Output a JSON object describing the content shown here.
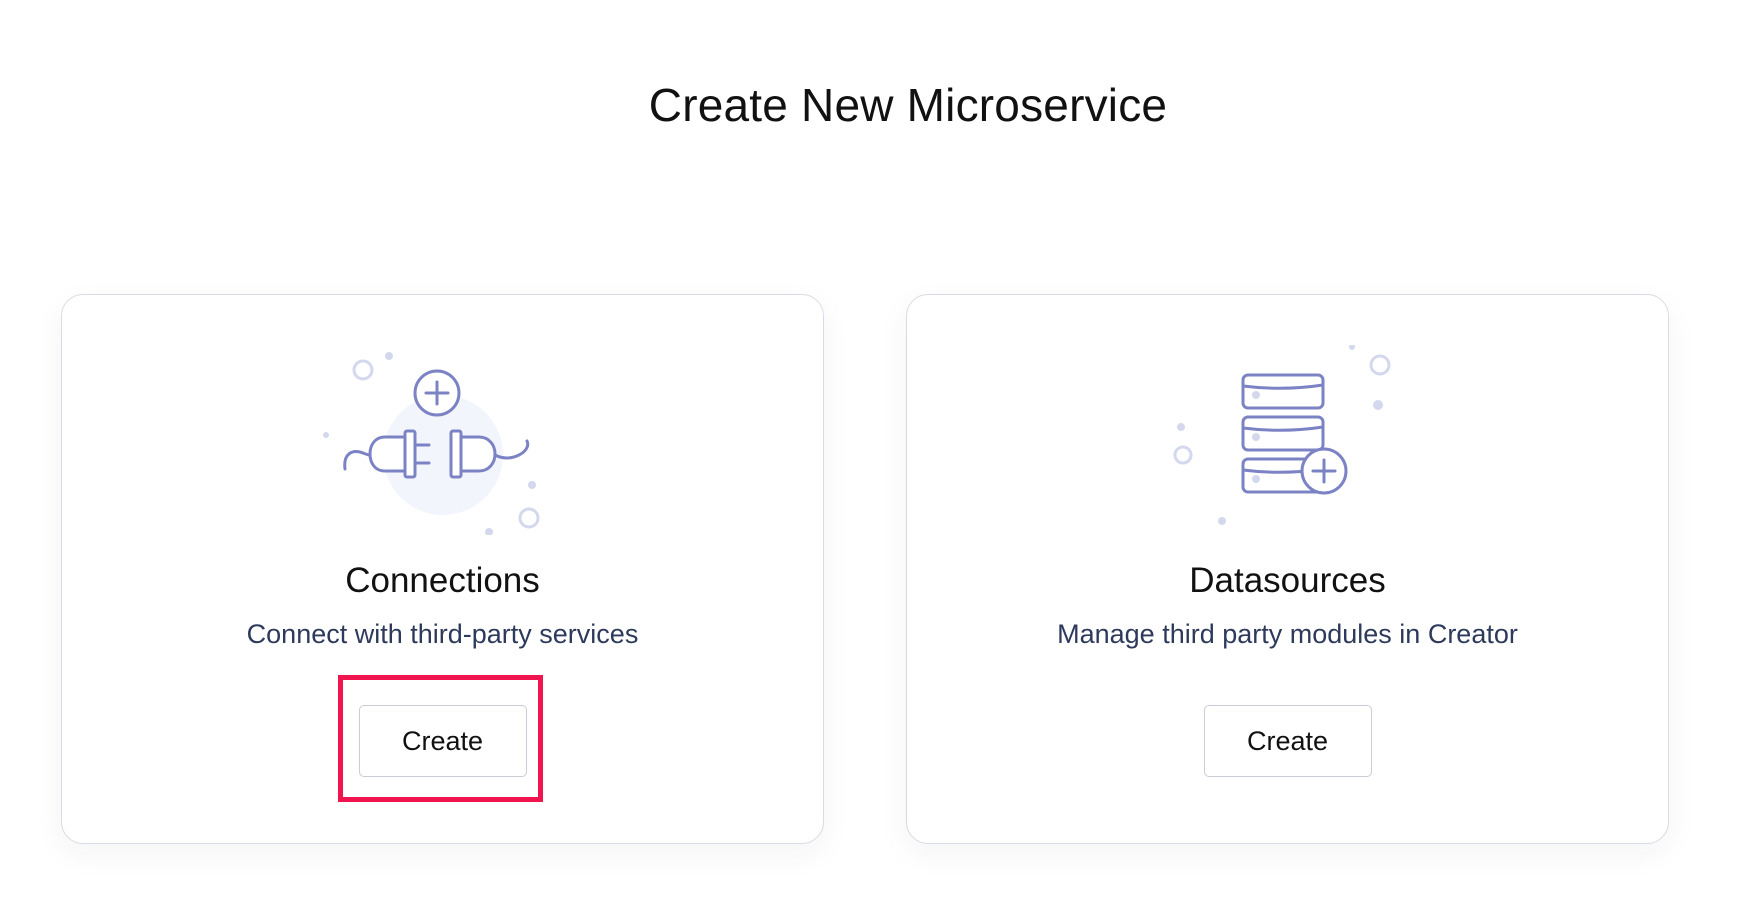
{
  "page": {
    "title": "Create New Microservice"
  },
  "cards": [
    {
      "icon": "plug-connection-icon",
      "title": "Connections",
      "description": "Connect with third-party services",
      "button_label": "Create",
      "highlighted": true
    },
    {
      "icon": "database-add-icon",
      "title": "Datasources",
      "description": "Manage third party modules in Creator",
      "button_label": "Create",
      "highlighted": false
    }
  ],
  "colors": {
    "illustration_stroke": "#7b83c4",
    "illustration_dots": "#d4d8ee",
    "highlight": "#f0154f",
    "description_text": "#2e3a5c"
  }
}
